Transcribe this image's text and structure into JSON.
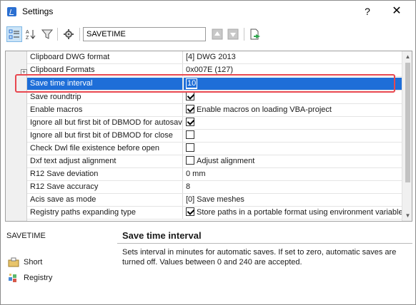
{
  "window": {
    "title": "Settings",
    "help_label": "?",
    "close_label": "✕"
  },
  "toolbar": {
    "search_value": "SAVETIME",
    "sort_label": "AZ"
  },
  "grid": {
    "rows": [
      {
        "name": "Clipboard DWG format",
        "value": "[4] DWG 2013"
      },
      {
        "name": "Clipboard Formats",
        "value": "0x007E (127)"
      },
      {
        "name": "Save time interval",
        "value": "10"
      },
      {
        "name": "Save roundtrip",
        "value": ""
      },
      {
        "name": "Enable macros",
        "value": "Enable macros on loading VBA-project"
      },
      {
        "name": "Ignore all but first bit of DBMOD for autosave",
        "value": ""
      },
      {
        "name": "Ignore all but first bit of DBMOD for close",
        "value": ""
      },
      {
        "name": "Check Dwl file existence before open",
        "value": ""
      },
      {
        "name": "Dxf text adjust alignment",
        "value": "Adjust alignment"
      },
      {
        "name": "R12 Save deviation",
        "value": "0 mm"
      },
      {
        "name": "R12 Save accuracy",
        "value": "8"
      },
      {
        "name": "Acis save as mode",
        "value": "[0] Save meshes"
      },
      {
        "name": "Registry paths expanding type",
        "value": "Store paths in a portable format using environment variables"
      }
    ]
  },
  "bottom": {
    "variable_name": "SAVETIME",
    "links": [
      "Short",
      "Registry"
    ],
    "desc_title": "Save time interval",
    "desc_text": "Sets interval in minutes for automatic saves. If set to zero, automatic saves are turned off. Values between 0 and 240 are accepted."
  },
  "colors": {
    "selection": "#1e6ed8",
    "highlight": "#e8474f",
    "accent": "#2a6fd1"
  }
}
